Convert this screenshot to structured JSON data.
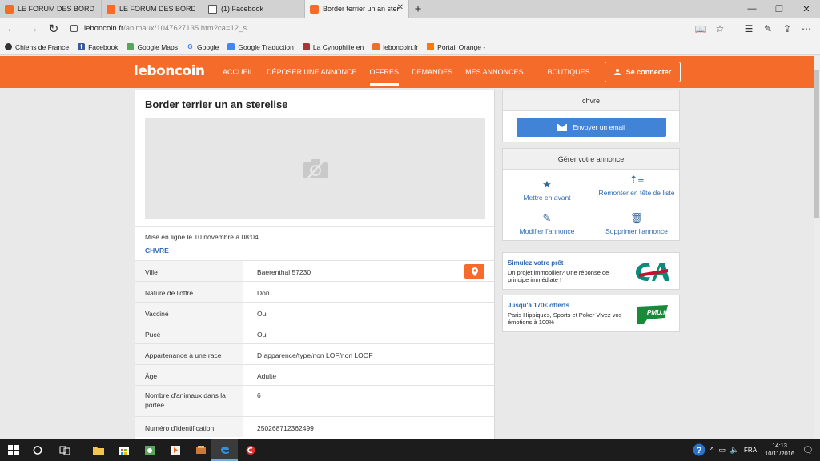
{
  "browser": {
    "tabs": [
      {
        "label": "LE FORUM DES BORDER TE",
        "favicon": "orange-square-icon"
      },
      {
        "label": "LE FORUM DES BORDER TE",
        "favicon": "orange-square-icon"
      },
      {
        "label": "(1) Facebook",
        "favicon": "page-icon"
      },
      {
        "label": "Border terrier un an stere",
        "favicon": "leboncoin-icon",
        "active": true
      }
    ],
    "url": {
      "domain": "leboncoin.fr",
      "path": "/animaux/1047627135.htm?ca=12_s"
    },
    "favorites": [
      {
        "label": "Chiens de France",
        "icon": "gear-icon"
      },
      {
        "label": "Facebook",
        "icon": "facebook-icon"
      },
      {
        "label": "Google Maps",
        "icon": "maps-icon"
      },
      {
        "label": "Google",
        "icon": "google-icon"
      },
      {
        "label": "Google Traduction",
        "icon": "translate-icon"
      },
      {
        "label": "La Cynophilie en",
        "icon": "paw-icon"
      },
      {
        "label": "leboncoin.fr",
        "icon": "leboncoin-icon"
      },
      {
        "label": "Portail Orange -",
        "icon": "orange-icon"
      }
    ]
  },
  "site": {
    "logo": "leboncoin",
    "nav": [
      "ACCUEIL",
      "DÉPOSER UNE ANNONCE",
      "OFFRES",
      "DEMANDES",
      "MES ANNONCES",
      "BOUTIQUES"
    ],
    "active_nav": "OFFRES",
    "connect": "Se connecter",
    "brand_color": "#f56b2a"
  },
  "ad": {
    "title": "Border terrier un an sterelise",
    "published": "Mise en ligne le 10 novembre à 08:04",
    "seller": "CHVRE",
    "attributes": [
      {
        "key": "Ville",
        "value": "Baerenthal 57230"
      },
      {
        "key": "Nature de l'offre",
        "value": "Don"
      },
      {
        "key": "Vacciné",
        "value": "Oui"
      },
      {
        "key": "Pucé",
        "value": "Oui"
      },
      {
        "key": "Appartenance à une race",
        "value": "D apparence/type/non LOF/non LOOF"
      },
      {
        "key": "Âge",
        "value": "Adulte"
      },
      {
        "key": "Nombre d'animaux dans la portée",
        "value": "6"
      },
      {
        "key": "Numéro d'identification",
        "value": "250268712362499"
      }
    ]
  },
  "contact": {
    "name": "chvre",
    "email_button": "Envoyer un email"
  },
  "manage": {
    "title": "Gérer votre annonce",
    "actions": [
      "Mettre en avant",
      "Remonter en tête de liste",
      "Modifier l'annonce",
      "Supprimer l'annonce"
    ]
  },
  "promos": [
    {
      "title": "Simulez votre prêt",
      "text": "Un projet immobilier? Une réponse de principe immédiate !",
      "logo": "credit-agricole-logo"
    },
    {
      "title": "Jusqu'à 170€ offerts",
      "text": "Paris Hippiques, Sports et Poker Vivez vos émotions à 100%",
      "logo": "pmu-logo",
      "logo_text": "PMU.fr"
    }
  ],
  "taskbar": {
    "lang": "FRA",
    "time": "14:13",
    "date": "10/11/2016"
  }
}
